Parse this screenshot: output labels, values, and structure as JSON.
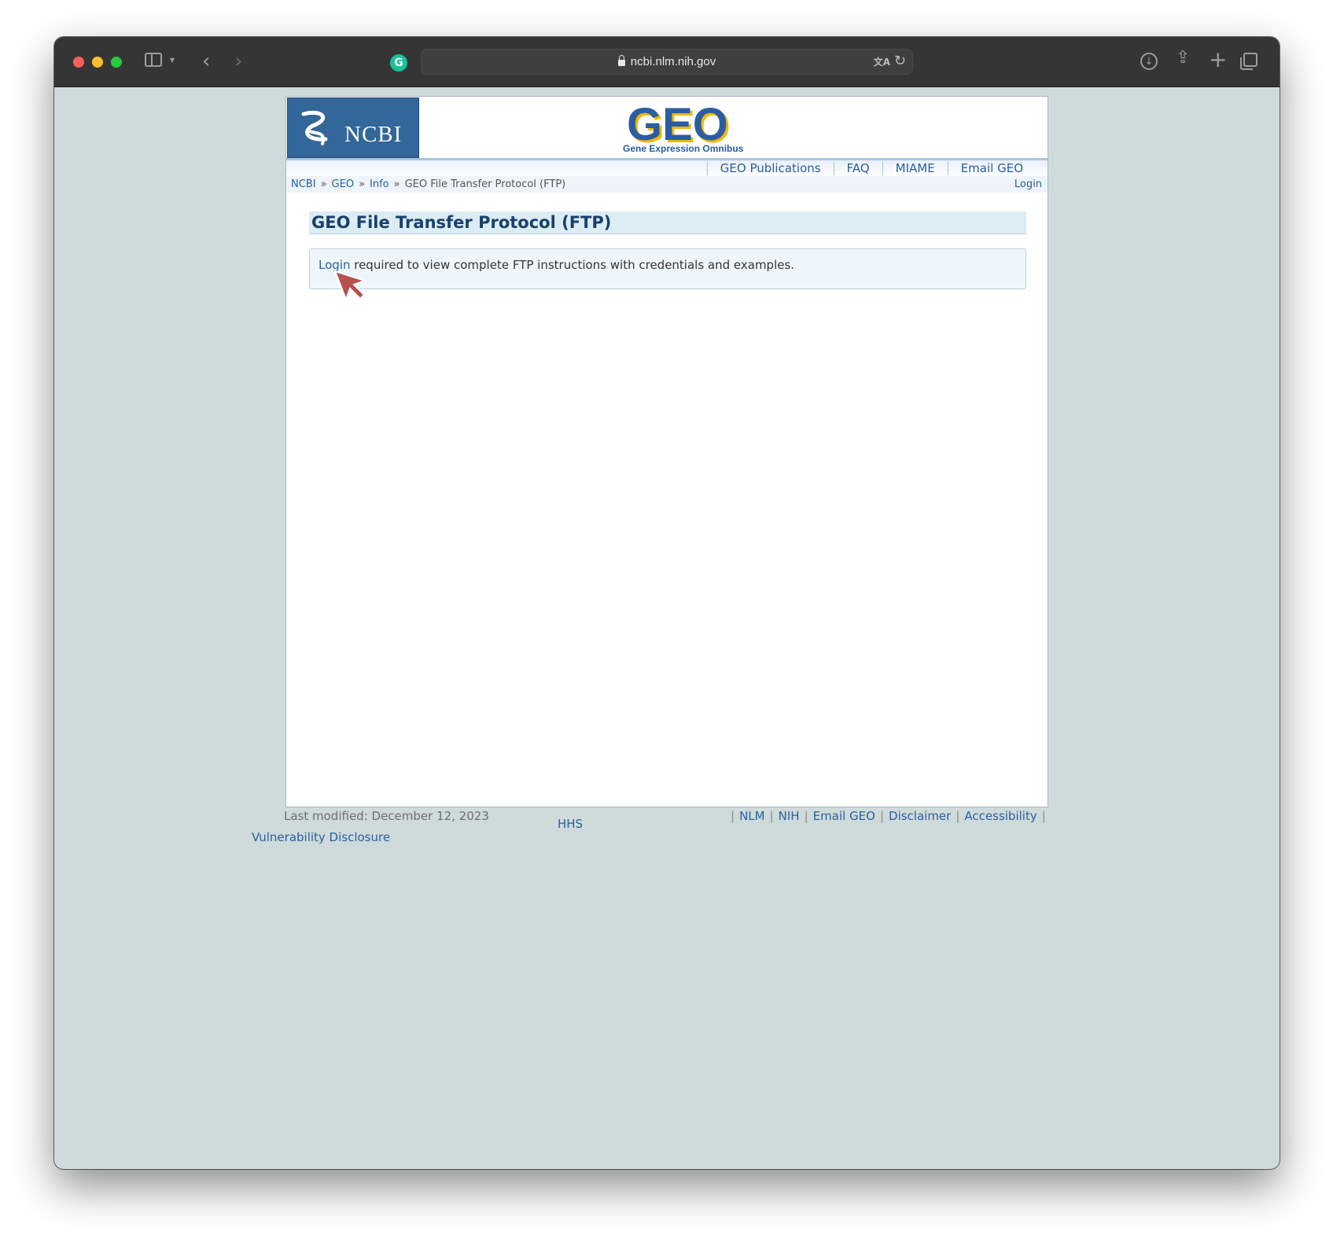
{
  "browser": {
    "url": "ncbi.nlm.nih.gov"
  },
  "header": {
    "ncbi_logo_text": "NCBI",
    "geo_logo_text": "GEO",
    "geo_tagline": "Gene Expression Omnibus",
    "nav": [
      {
        "label": "GEO Publications"
      },
      {
        "label": "FAQ"
      },
      {
        "label": "MIAME"
      },
      {
        "label": "Email GEO"
      }
    ]
  },
  "breadcrumb": {
    "items": [
      "NCBI",
      "GEO",
      "Info"
    ],
    "separator": "»",
    "current": "GEO File Transfer Protocol (FTP)",
    "login": "Login"
  },
  "main": {
    "title": "GEO File Transfer Protocol (FTP)",
    "notice_link": "Login",
    "notice_text": " required to view complete FTP instructions with credentials and examples."
  },
  "footer": {
    "last_modified": "Last modified: December 12, 2023",
    "hhs": "HHS",
    "links": [
      {
        "label": "NLM"
      },
      {
        "label": "NIH"
      },
      {
        "label": "Email GEO"
      },
      {
        "label": "Disclaimer"
      },
      {
        "label": "Accessibility"
      }
    ],
    "separator": "|",
    "vulnerability": "Vulnerability Disclosure"
  },
  "colors": {
    "toolbar_bg": "#353535",
    "page_bg": "#cfdbda",
    "ncbi_blue": "#336699",
    "link_blue": "#2a5ea0",
    "title_blue": "#1a3f6e",
    "geo_gold": "#f2b705"
  },
  "icons": {
    "sidebar": "sidebar-icon",
    "back": "chevron-left-icon",
    "forward": "chevron-right-icon",
    "grammarly": "grammarly-icon",
    "lock": "lock-icon",
    "translate": "translate-icon",
    "reload": "reload-icon",
    "download": "download-icon",
    "share": "share-icon",
    "new_tab": "plus-icon",
    "tab_overview": "tabs-icon",
    "cursor": "mouse-cursor-icon"
  }
}
